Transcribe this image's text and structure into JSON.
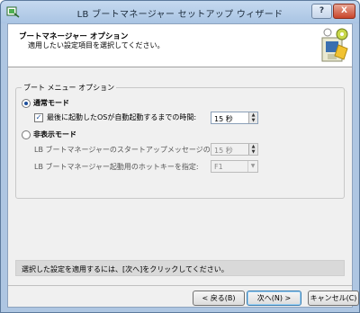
{
  "window": {
    "title": "LB ブートマネージャー セットアップ ウィザード",
    "help_label": "?",
    "close_label": "X"
  },
  "header": {
    "title": "ブートマネージャー オプション",
    "subtitle": "適用したい設定項目を選択してください。"
  },
  "group": {
    "label": "ブート メニュー オプション",
    "normal_mode": {
      "label": "通常モード",
      "selected": true,
      "timeout_checkbox_label": "最後に起動したOSが自動起動するまでの時間:",
      "timeout_checked": true,
      "timeout_value": "15 秒"
    },
    "hidden_mode": {
      "label": "非表示モード",
      "selected": false,
      "startup_message_label": "LB ブートマネージャーのスタートアップメッセージの表示時間:",
      "startup_message_value": "15 秒",
      "hotkey_label": "LB ブートマネージャー起動用のホットキーを指定:",
      "hotkey_value": "F1"
    }
  },
  "info": {
    "text": "選択した設定を適用するには、[次へ]をクリックしてください。"
  },
  "buttons": {
    "back": "< 戻る(B)",
    "next": "次へ(N) >",
    "cancel": "キャンセル(C)"
  },
  "check_mark": "✓",
  "spin_up": "▲",
  "spin_down": "▼",
  "combo_arrow": "▼",
  "colors": {
    "titlebar": "#aec6e2",
    "close_button": "#c8442a",
    "accent_radio": "#1d4f9c"
  }
}
